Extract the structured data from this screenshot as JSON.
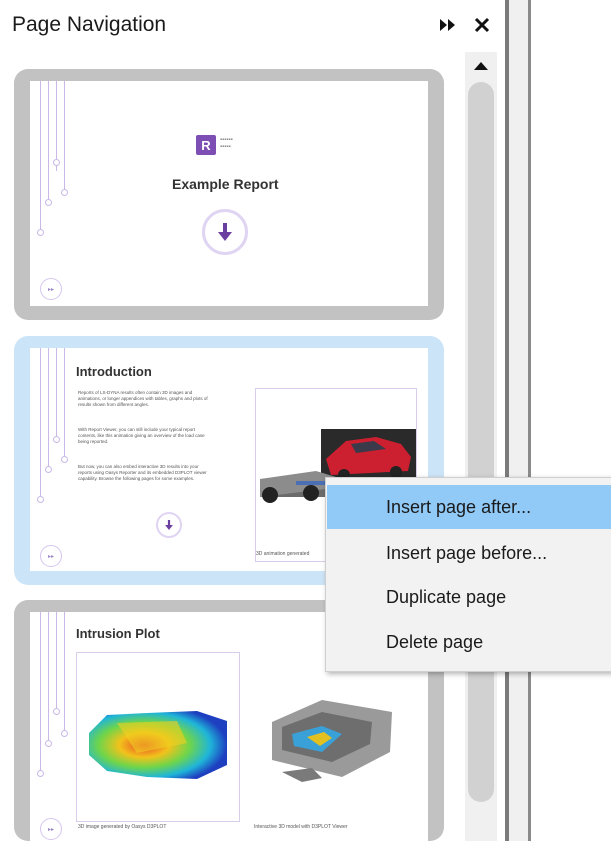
{
  "panel": {
    "title": "Page Navigation",
    "pin_icon": "double-arrow-right-icon",
    "close_icon": "close-icon"
  },
  "scrollbar": {
    "up_icon": "triangle-up-icon"
  },
  "pages": [
    {
      "logo_letter": "R",
      "title": "Example Report"
    },
    {
      "title": "Introduction",
      "paragraph_1": "Reports of LS-DYNA results often contain 3D images and animations, or longer appendices with tables, graphs and plots of results shown from different angles.",
      "paragraph_2": "With Report Viewer, you can still include your typical report contents, like this animation giving an overview of the load case being reported.",
      "paragraph_3": "But now, you can also embed interactive 3D results into your reports using Oasys Reporter and its embedded D3PLOT viewer capability. Browse the following pages for some examples.",
      "image_caption": "3D animation generated"
    },
    {
      "title": "Intrusion Plot",
      "caption_left": "3D image generated by Oasys D3PLOT",
      "caption_right": "Interactive 3D model with D3PLOT Viewer"
    }
  ],
  "context_menu": {
    "items": [
      {
        "label": "Insert page after..."
      },
      {
        "label": "Insert page before..."
      },
      {
        "label": "Duplicate page"
      },
      {
        "label": "Delete page"
      }
    ]
  },
  "colors": {
    "accent_purple": "#7d4fb5",
    "selection_blue": "#cce4f7",
    "menu_highlight": "#91c9f7"
  }
}
